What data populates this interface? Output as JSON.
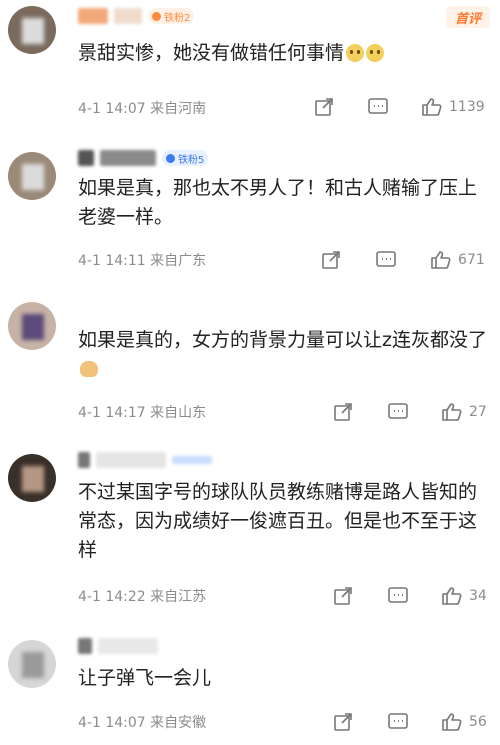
{
  "comments": [
    {
      "badge": "铁粉2",
      "text": "景甜实惨，她没有做错任何事情",
      "emojis": [
        "sad-face-emoji",
        "sad-face-emoji"
      ],
      "time": "4-1 14:07 来自河南",
      "likes": "1139",
      "tag": "首评"
    },
    {
      "badge": "铁粉5",
      "text": "如果是真，那也太不男人了！和古人赌输了压上老婆一样。",
      "time": "4-1 14:11 来自广东",
      "likes": "671"
    },
    {
      "text": "如果是真的，女方的背景力量可以让z连灰都没了",
      "emojis": [
        "doge-emoji"
      ],
      "time": "4-1 14:17 来自山东",
      "likes": "27"
    },
    {
      "text": "不过某国字号的球队队员教练赌博是路人皆知的常态，因为成绩好一俊遮百丑。但是也不至于这样",
      "time": "4-1 14:22 来自江苏",
      "likes": "34"
    },
    {
      "text": "让子弹飞一会儿",
      "time": "4-1 14:07 来自安徽",
      "likes": "56"
    }
  ],
  "colors": {
    "badge_orange": "#ff8a3c",
    "badge_blue": "#3c7cf0",
    "meta_gray": "#8c8c8c",
    "text": "#222222"
  },
  "icons": [
    "share-icon",
    "comment-icon",
    "like-icon"
  ]
}
